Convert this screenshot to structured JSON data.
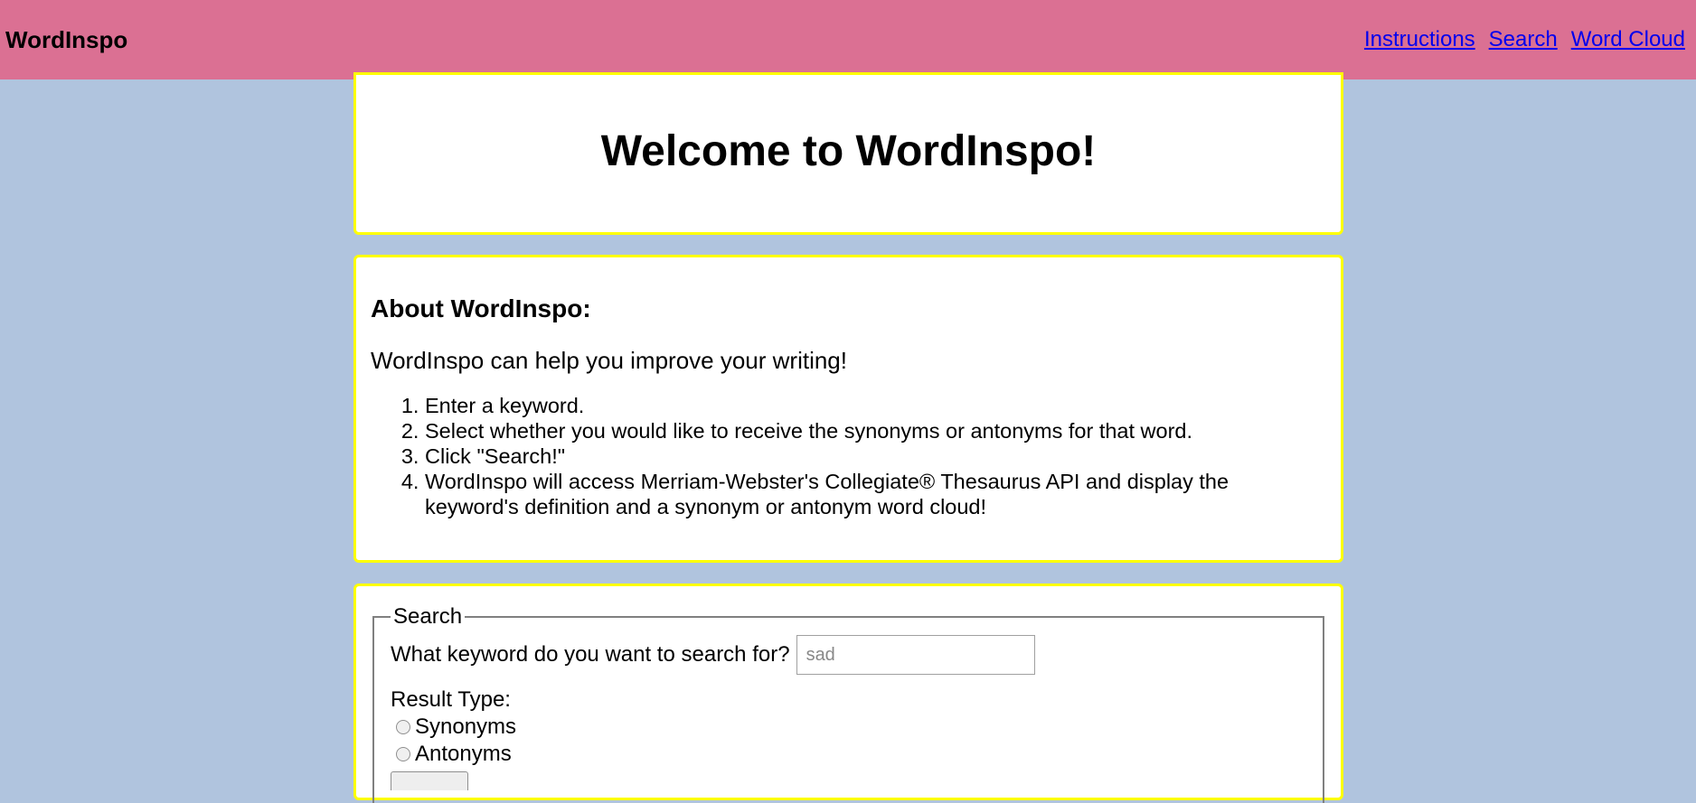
{
  "header": {
    "brand": "WordInspo",
    "nav": [
      "Instructions",
      "Search",
      "Word Cloud"
    ]
  },
  "welcome": {
    "title": "Welcome to WordInspo!"
  },
  "about": {
    "heading": "About WordInspo:",
    "intro": "WordInspo can help you improve your writing!",
    "steps": [
      "Enter a keyword.",
      "Select whether you would like to receive the synonyms or antonyms for that word.",
      "Click \"Search!\"",
      "WordInspo will access Merriam-Webster's Collegiate® Thesaurus API and display the keyword's definition and a synonym or antonym word cloud!"
    ]
  },
  "search": {
    "legend": "Search",
    "keyword_label": "What keyword do you want to search for?",
    "keyword_placeholder": "sad",
    "keyword_value": "",
    "result_type_label": "Result Type:",
    "options": [
      "Synonyms",
      "Antonyms"
    ]
  },
  "colors": {
    "header_bg": "#db7093",
    "page_bg": "#b0c4de",
    "card_border": "#ffff00",
    "link": "#0000ee"
  }
}
